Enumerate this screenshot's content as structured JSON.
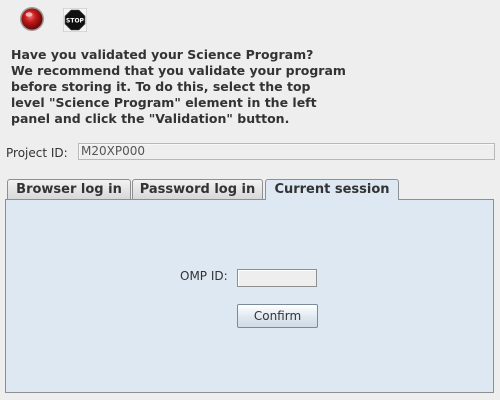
{
  "toolbar": {
    "icons": [
      "red-ball-icon",
      "stop-sign-icon"
    ],
    "stop_label": "STOP"
  },
  "message": {
    "lines": [
      "Have you validated your Science Program?",
      "We recommend that you validate your program",
      "before storing it. To do this, select the top",
      "level \"Science Program\" element in the left",
      "panel and click the \"Validation\" button."
    ]
  },
  "project": {
    "label": "Project ID:",
    "value": "M20XP000"
  },
  "tabs": [
    {
      "label": "Browser log in",
      "active": false
    },
    {
      "label": "Password log in",
      "active": false
    },
    {
      "label": "Current session",
      "active": true
    }
  ],
  "session": {
    "omp_label": "OMP ID:",
    "omp_value": "",
    "confirm_label": "Confirm"
  },
  "colors": {
    "background": "#eeeeee",
    "active_tab": "#dde8f3",
    "border": "#8e8f91",
    "text": "#333333"
  }
}
